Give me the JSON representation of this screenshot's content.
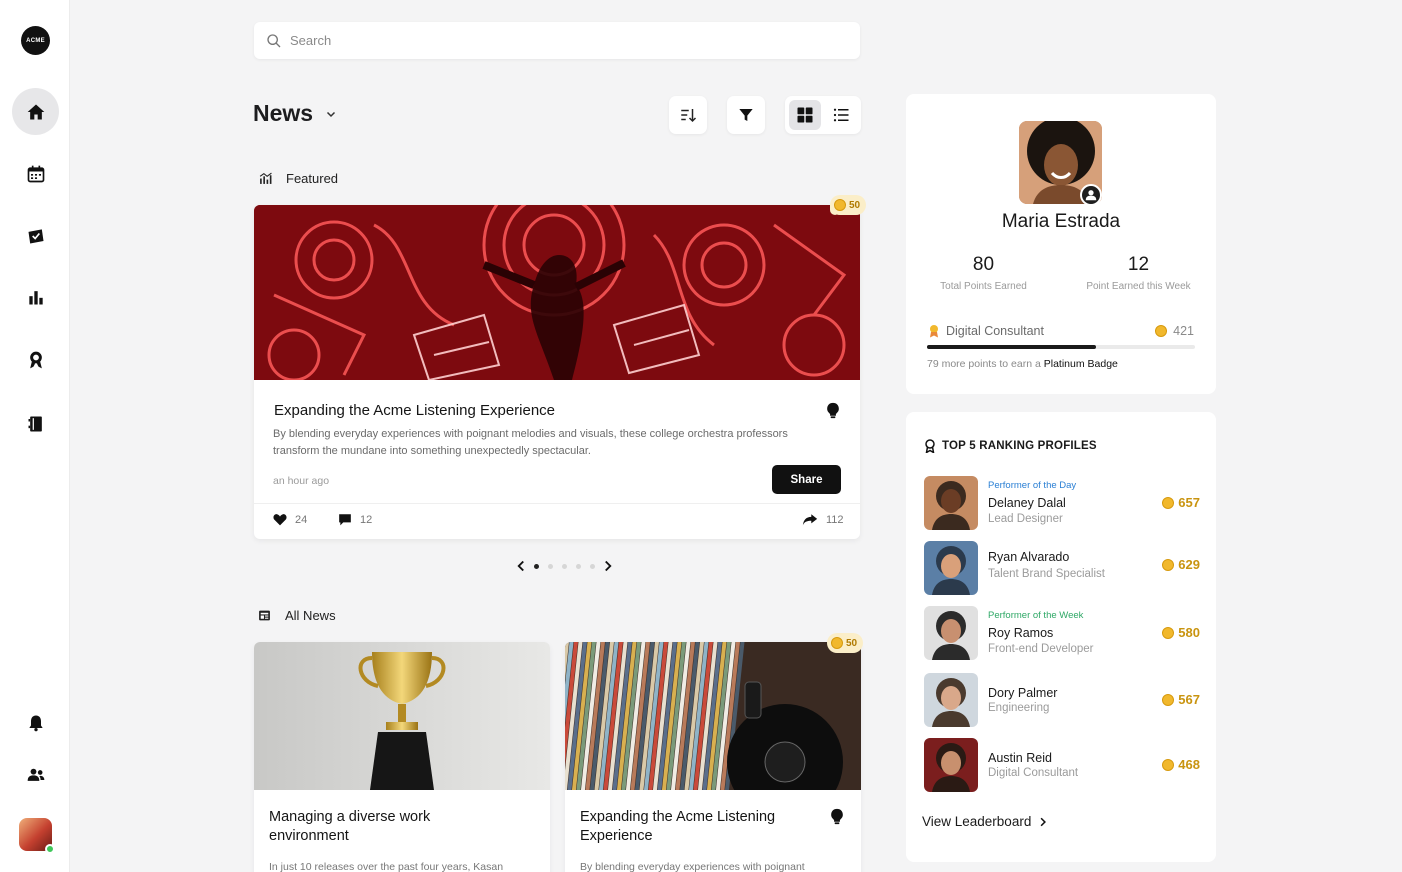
{
  "app": {
    "logo_text": "ACME"
  },
  "sidebar": {
    "items": [
      {
        "name": "home-icon",
        "active": true
      },
      {
        "name": "calendar-icon",
        "active": false
      },
      {
        "name": "ticket-icon",
        "active": false
      },
      {
        "name": "bar-chart-icon",
        "active": false
      },
      {
        "name": "award-icon",
        "active": false
      },
      {
        "name": "book-icon",
        "active": false
      }
    ],
    "bottom": [
      "bell-icon",
      "users-icon"
    ]
  },
  "search": {
    "placeholder": "Search",
    "value": ""
  },
  "news": {
    "title": "News",
    "featured_label": "Featured",
    "all_news_label": "All News",
    "view_mode": "grid"
  },
  "featured": {
    "points": "50",
    "title": "Expanding the Acme Listening Experience",
    "description": "By blending everyday experiences with poignant melodies and visuals, these college orchestra professors transform the mundane into something unexpectedly spectacular.",
    "time": "an hour ago",
    "share_label": "Share",
    "likes": "24",
    "comments": "12",
    "shares": "112",
    "page": 1,
    "page_count": 5
  },
  "all_news": [
    {
      "title": "Managing a diverse work environment",
      "description": "In just 10 releases over the past four years, Kasan",
      "points": ""
    },
    {
      "title": "Expanding the Acme Listening Experience",
      "description": "By blending everyday experiences with poignant",
      "points": "50"
    }
  ],
  "profile": {
    "name": "Maria Estrada",
    "total_points": "80",
    "total_points_label": "Total Points Earned",
    "week_points": "12",
    "week_points_label": "Point Earned this Week",
    "role": "Digital Consultant",
    "role_points": "421",
    "progress": 0.63,
    "note_prefix": "79 more points to earn a",
    "note_badge": "Platinum Badge"
  },
  "ranking": {
    "title": "TOP 5 RANKING PROFILES",
    "link": "View Leaderboard",
    "rows": [
      {
        "tag": "Performer of the Day",
        "tag_color": "#2a7fd4",
        "name": "Delaney Dalal",
        "role": "Lead Designer",
        "points": "657"
      },
      {
        "tag": "",
        "tag_color": "",
        "name": "Ryan Alvarado",
        "role": "Talent Brand Specialist",
        "points": "629"
      },
      {
        "tag": "Performer of the Week",
        "tag_color": "#2fa866",
        "name": "Roy Ramos",
        "role": "Front-end Developer",
        "points": "580"
      },
      {
        "tag": "",
        "tag_color": "",
        "name": "Dory Palmer",
        "role": "Engineering",
        "points": "567"
      },
      {
        "tag": "",
        "tag_color": "",
        "name": "Austin Reid",
        "role": "Digital Consultant",
        "points": "468"
      }
    ]
  }
}
